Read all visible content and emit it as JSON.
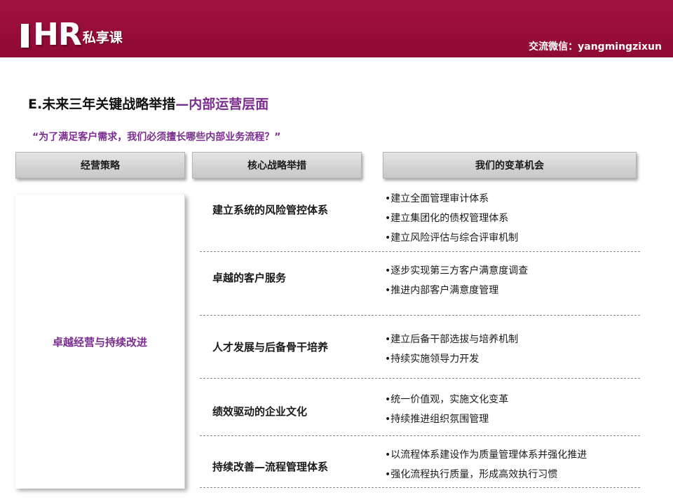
{
  "header": {
    "logo_letters": "HR",
    "logo_suffix": "私享课",
    "wechat": "交流微信：yangmingzixun",
    "colors": {
      "band": "#96103a",
      "accent_purple": "#7b2d8f"
    }
  },
  "title": {
    "main": "E.未来三年关键战略举措",
    "accent": "—内部运营层面"
  },
  "subtitle": "“为了满足客户需求，我们必须擅长哪些内部业务流程？”",
  "columns": [
    "经营策略",
    "核心战略举措",
    "我们的变革机会"
  ],
  "strategy": "卓越经营与持续改进",
  "rows": [
    {
      "initiative": "建立系统的风险管控体系",
      "opportunities": [
        "•建立全面管理审计体系",
        "•建立集团化的债权管理体系",
        "•建立风险评估与综合评审机制"
      ]
    },
    {
      "initiative": "卓越的客户服务",
      "opportunities": [
        "•逐步实现第三方客户满意度调查",
        "•推进内部客户满意度管理"
      ]
    },
    {
      "initiative": "人才发展与后备骨干培养",
      "opportunities": [
        "•建立后备干部选拔与培养机制",
        "•持续实施领导力开发"
      ]
    },
    {
      "initiative": "绩效驱动的企业文化",
      "opportunities": [
        "•统一价值观，实施文化变革",
        "•持续推进组织氛围管理"
      ]
    },
    {
      "initiative": "持续改善—流程管理体系",
      "opportunities": [
        "•以流程体系建设作为质量管理体系并强化推进",
        "•强化流程执行质量，形成高效执行习惯"
      ]
    }
  ]
}
